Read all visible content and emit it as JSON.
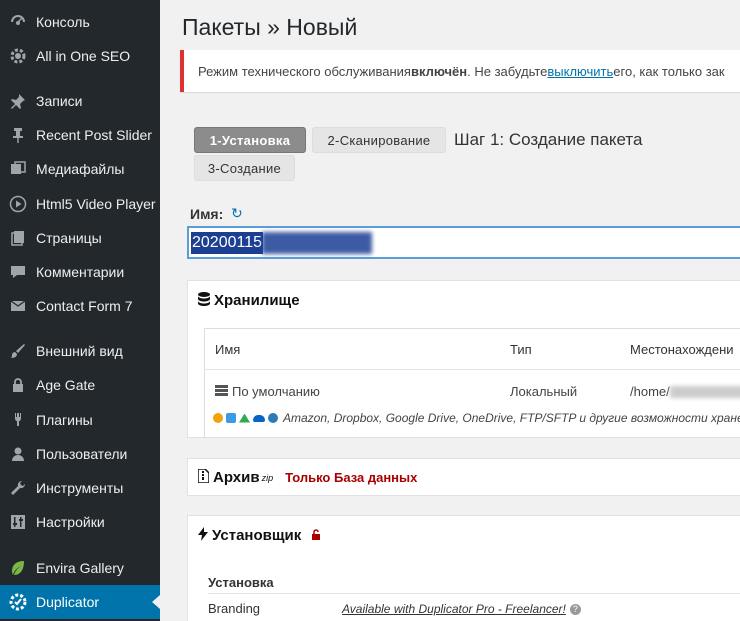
{
  "sidebar": {
    "items": [
      {
        "label": "Консоль",
        "icon": "dashboard-icon"
      },
      {
        "label": "All in One SEO",
        "icon": "gear-icon"
      },
      {
        "label": "Записи",
        "icon": "pushpin-icon"
      },
      {
        "label": "Recent Post Slider",
        "icon": "pin-icon"
      },
      {
        "label": "Медиафайлы",
        "icon": "media-icon"
      },
      {
        "label": "Html5 Video Player",
        "icon": "play-icon"
      },
      {
        "label": "Страницы",
        "icon": "pages-icon"
      },
      {
        "label": "Комментарии",
        "icon": "comment-icon"
      },
      {
        "label": "Contact Form 7",
        "icon": "mail-icon"
      },
      {
        "label": "Внешний вид",
        "icon": "brush-icon"
      },
      {
        "label": "Age Gate",
        "icon": "lock-icon"
      },
      {
        "label": "Плагины",
        "icon": "plugin-icon"
      },
      {
        "label": "Пользователи",
        "icon": "user-icon"
      },
      {
        "label": "Инструменты",
        "icon": "wrench-icon"
      },
      {
        "label": "Настройки",
        "icon": "settings-icon"
      },
      {
        "label": "Envira Gallery",
        "icon": "leaf-icon"
      },
      {
        "label": "Duplicator",
        "icon": "duplicator-icon"
      }
    ]
  },
  "page": {
    "title": "Пакеты » Новый"
  },
  "notice": {
    "before": "Режим технического обслуживания ",
    "bold": "включён",
    "mid": ". Не забудьте ",
    "link": "выключить",
    "after": " его, как только зак"
  },
  "steps": {
    "step1": "1-Установка",
    "step2": "2-Сканирование",
    "step3": "3-Создание",
    "title": "Шаг 1: Создание пакета"
  },
  "name": {
    "label": "Имя:",
    "value": "20200115"
  },
  "storage": {
    "title": "Хранилище",
    "col_name": "Имя",
    "col_type": "Тип",
    "col_location": "Местонахождени",
    "row_name": "По умолчанию",
    "row_type": "Локальный",
    "row_location": "/home/",
    "providers": "Amazon, Dropbox, Google Drive, OneDrive, FTP/SFTP и другие возможности хранен"
  },
  "archive": {
    "title": "Архив",
    "sup": "zip",
    "filter": "Только База данных"
  },
  "installer": {
    "title": "Установщик",
    "section": "Установка",
    "branding_label": "Branding",
    "branding_value": "Available with Duplicator Pro - Freelancer!"
  },
  "colors": {
    "sidebar": "#23282d",
    "active": "#0073aa",
    "notice_border": "#dc3232",
    "filter": "#aa0000"
  }
}
